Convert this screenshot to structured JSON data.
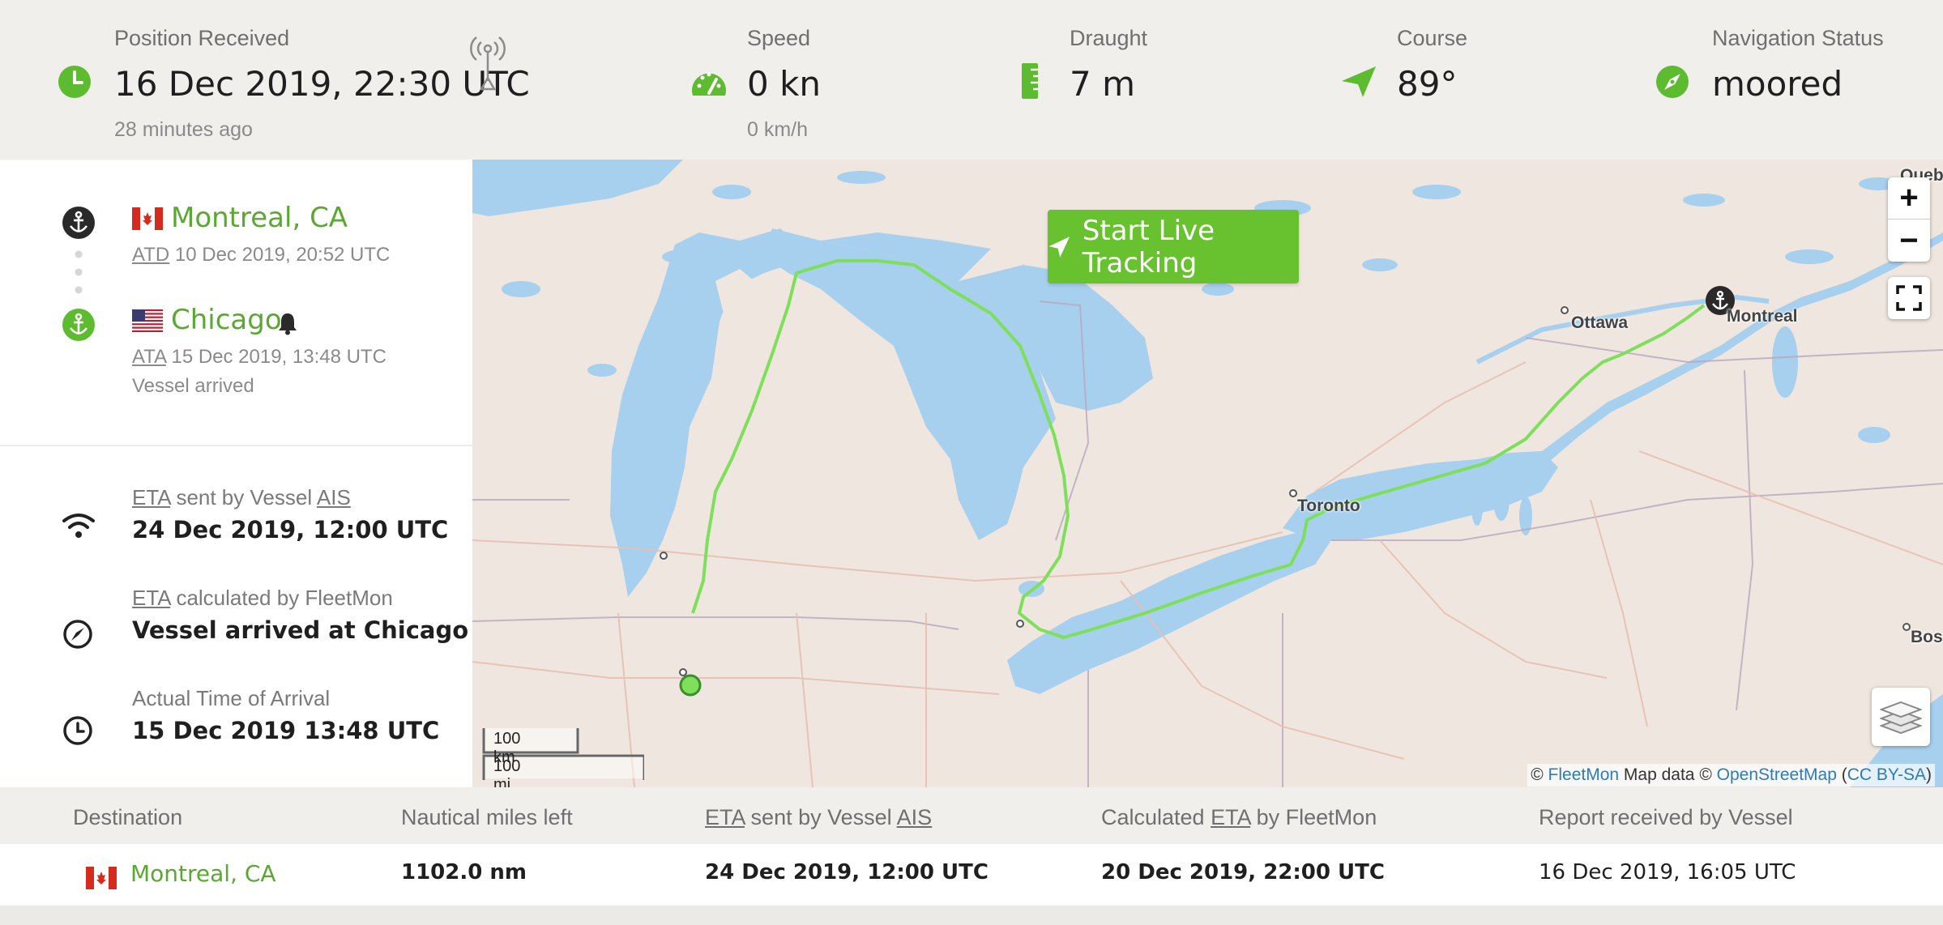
{
  "top_stats": {
    "position": {
      "label": "Position Received",
      "value": "16 Dec 2019, 22:30 UTC",
      "sub": "28 minutes ago"
    },
    "speed": {
      "label": "Speed",
      "value": "0 kn",
      "sub": "0 km/h"
    },
    "draught": {
      "label": "Draught",
      "value": "7 m"
    },
    "course": {
      "label": "Course",
      "value": "89°"
    },
    "nav_status": {
      "label": "Navigation Status",
      "value": "moored"
    }
  },
  "voyage": {
    "departure": {
      "port": "Montreal, CA",
      "abbr": "ATD",
      "time": "10 Dec 2019, 20:52 UTC"
    },
    "arrival": {
      "port": "Chicago",
      "abbr": "ATA",
      "time": "15 Dec 2019, 13:48 UTC",
      "status": "Vessel arrived"
    }
  },
  "eta": {
    "ais": {
      "abbr1": "ETA",
      "mid": "sent by Vessel",
      "abbr2": "AIS",
      "value": "24 Dec 2019, 12:00 UTC"
    },
    "fleetmon": {
      "abbr": "ETA",
      "rest": "calculated by FleetMon",
      "value": "Vessel arrived at Chicago"
    },
    "actual": {
      "label": "Actual Time of Arrival",
      "value": "15 Dec 2019 13:48 UTC"
    }
  },
  "map": {
    "button": "Start Live Tracking",
    "zoom_in": "+",
    "zoom_out": "−",
    "cities": {
      "ottawa": "Ottawa",
      "montreal": "Montreal",
      "toronto": "Toronto",
      "quebec": "Queb",
      "boston": "Bos"
    },
    "scale_km": "100 km",
    "scale_mi": "100 mi",
    "attribution": {
      "c1": "© ",
      "fleetmon": "FleetMon",
      "mapdata": " Map data © ",
      "osm": "OpenStreetMap",
      "open": " (",
      "license": "CC BY-SA",
      "close": ")"
    },
    "colors": {
      "water": "#a7cfee",
      "land": "#efe7df",
      "track": "#7ee05a"
    }
  },
  "table": {
    "headers": {
      "destination": "Destination",
      "nm_left": "Nautical miles left",
      "eta_ais_abbr": "ETA",
      "eta_ais_mid": "sent by Vessel",
      "eta_ais_ais": "AIS",
      "calc_pre": "Calculated",
      "calc_abbr": "ETA",
      "calc_post": "by FleetMon",
      "report": "Report received by Vessel"
    },
    "row": {
      "destination": "Montreal, CA",
      "nm_left": "1102.0 nm",
      "eta_ais": "24 Dec 2019, 12:00 UTC",
      "eta_calc": "20 Dec 2019, 22:00 UTC",
      "report": "16 Dec 2019, 16:05 UTC"
    }
  }
}
